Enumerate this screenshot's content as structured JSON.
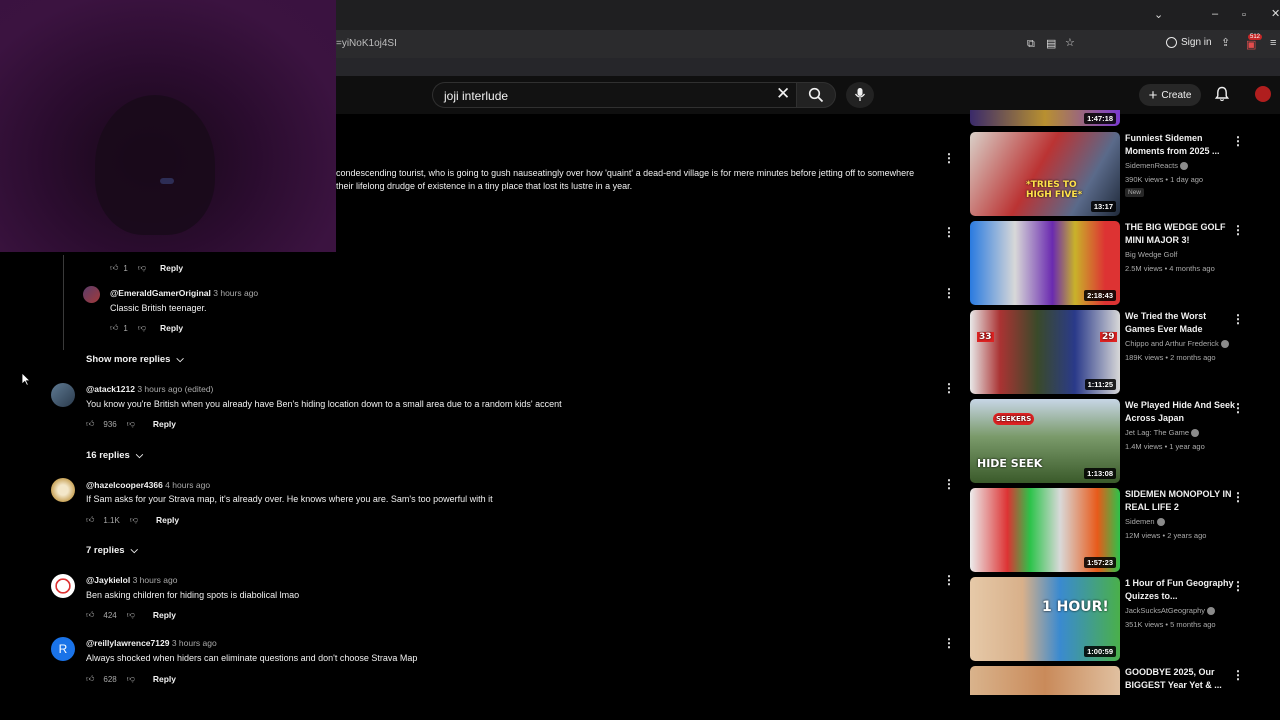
{
  "browser": {
    "url_fragment": "=yiNoK1oj4SI",
    "sign_in": "Sign in",
    "extension_badge": "512"
  },
  "header": {
    "search_query": "joji interlude",
    "create_label": "Create"
  },
  "partial_comment": {
    "line1": "condescending tourist, who is going to gush nauseatingly over how 'quaint' a dead-end village is for mere minutes before jetting off to somewhere",
    "line2": "their lifelong drudge of existence in a tiny place that lost its lustre in a year."
  },
  "comments": [
    {
      "author": "",
      "time": "",
      "text": "",
      "likes": "1",
      "reply": "Reply"
    },
    {
      "author": "@EmeraldGamerOriginal",
      "time": "3 hours ago",
      "text": "Classic British teenager.",
      "likes": "1",
      "reply": "Reply"
    },
    {
      "author": "@atack1212",
      "time": "3 hours ago (edited)",
      "text": "You know you're British when you already have Ben's hiding location down to a small area due to a random kids' accent",
      "likes": "936",
      "reply": "Reply",
      "replies_label": "16 replies"
    },
    {
      "author": "@hazelcooper4366",
      "time": "4 hours ago",
      "text": "If Sam asks for your Strava map, it's already over. He knows where you are. Sam's too powerful with it",
      "likes": "1.1K",
      "reply": "Reply",
      "replies_label": "7 replies"
    },
    {
      "author": "@Jaykielol",
      "time": "3 hours ago",
      "text": "Ben asking children for hiding spots is diabolical lmao",
      "likes": "424",
      "reply": "Reply"
    },
    {
      "author": "@reillylawrence7129",
      "time": "3 hours ago",
      "text": "Always shocked when hiders can eliminate questions and don't choose Strava Map",
      "likes": "628",
      "reply": "Reply",
      "avatar_letter": "R"
    }
  ],
  "show_more_replies": "Show more replies",
  "sidebar": {
    "top_partial_duration": "1:47:18",
    "videos": [
      {
        "title": "Funniest Sidemen Moments from 2025 ...",
        "channel": "SidemenReacts",
        "meta": "390K views • 1 day ago",
        "badge": "New",
        "duration": "13:17",
        "thumb_text": "*TRIES TO HIGH FIVE*"
      },
      {
        "title": "THE BIG WEDGE GOLF MINI MAJOR 3!",
        "channel": "Big Wedge Golf",
        "meta": "2.5M views • 4 months ago",
        "duration": "2:18:43"
      },
      {
        "title": "We Tried the Worst Games Ever Made",
        "channel": "Chippo and Arthur Frederick",
        "meta": "189K views • 2 months ago",
        "duration": "1:11:25",
        "thumb_text_left": "33",
        "thumb_text_right": "29"
      },
      {
        "title": "We Played Hide And Seek Across Japan",
        "channel": "Jet Lag: The Game",
        "meta": "1.4M views • 1 year ago",
        "duration": "1:13:08",
        "thumb_text": "HIDE SEEK",
        "thumb_sign": "SEEKERS"
      },
      {
        "title": "SIDEMEN MONOPOLY IN REAL LIFE 2",
        "channel": "Sidemen",
        "meta": "12M views • 2 years ago",
        "duration": "1:57:23"
      },
      {
        "title": "1 Hour of Fun Geography Quizzes to...",
        "channel": "JackSucksAtGeography",
        "meta": "351K views • 5 months ago",
        "duration": "1:00:59",
        "thumb_text": "1 HOUR!"
      },
      {
        "title": "GOODBYE 2025, Our BIGGEST Year Yet & ...",
        "channel": "",
        "meta": "",
        "duration": ""
      }
    ]
  }
}
